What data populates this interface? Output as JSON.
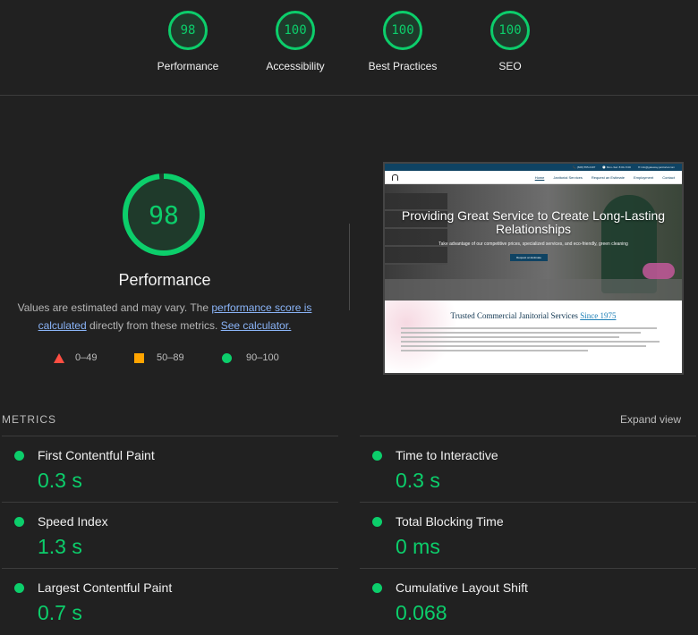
{
  "top_gauges": [
    {
      "score": "98",
      "label": "Performance"
    },
    {
      "score": "100",
      "label": "Accessibility"
    },
    {
      "score": "100",
      "label": "Best Practices"
    },
    {
      "score": "100",
      "label": "SEO"
    }
  ],
  "main_gauge": {
    "score": "98",
    "title": "Performance",
    "desc_prefix": "Values are estimated and may vary. The ",
    "desc_link": "performance score is calculated",
    "desc_middle": " directly from these metrics. ",
    "desc_link2": "See calculator.",
    "color": "#0cce6b"
  },
  "legend": {
    "fail": "0–49",
    "average": "50–89",
    "pass": "90–100"
  },
  "screenshot": {
    "topbar": [
      "📞 (608) 555-0197",
      "🕘 Mon–Sat: 8:00–5:00",
      "✉ info@gateway-janitorial.com"
    ],
    "menu": [
      "Home",
      "Janitorial Services",
      "Request an Estimate",
      "Employment",
      "Contact"
    ],
    "hero_title": "Providing Great Service to Create Long-Lasting Relationships",
    "hero_sub": "Take advantage of our competitive prices, specialized services, and eco-friendly, green cleaning",
    "hero_button": "Request an Estimate",
    "section_title": "Trusted Commercial Janitorial Services",
    "section_highlight": "Since 1975"
  },
  "metrics_header": "METRICS",
  "expand_view": "Expand view",
  "metrics": [
    {
      "name": "First Contentful Paint",
      "value": "0.3 s"
    },
    {
      "name": "Time to Interactive",
      "value": "0.3 s"
    },
    {
      "name": "Speed Index",
      "value": "1.3 s"
    },
    {
      "name": "Total Blocking Time",
      "value": "0 ms"
    },
    {
      "name": "Largest Contentful Paint",
      "value": "0.7 s"
    },
    {
      "name": "Cumulative Layout Shift",
      "value": "0.068"
    }
  ]
}
